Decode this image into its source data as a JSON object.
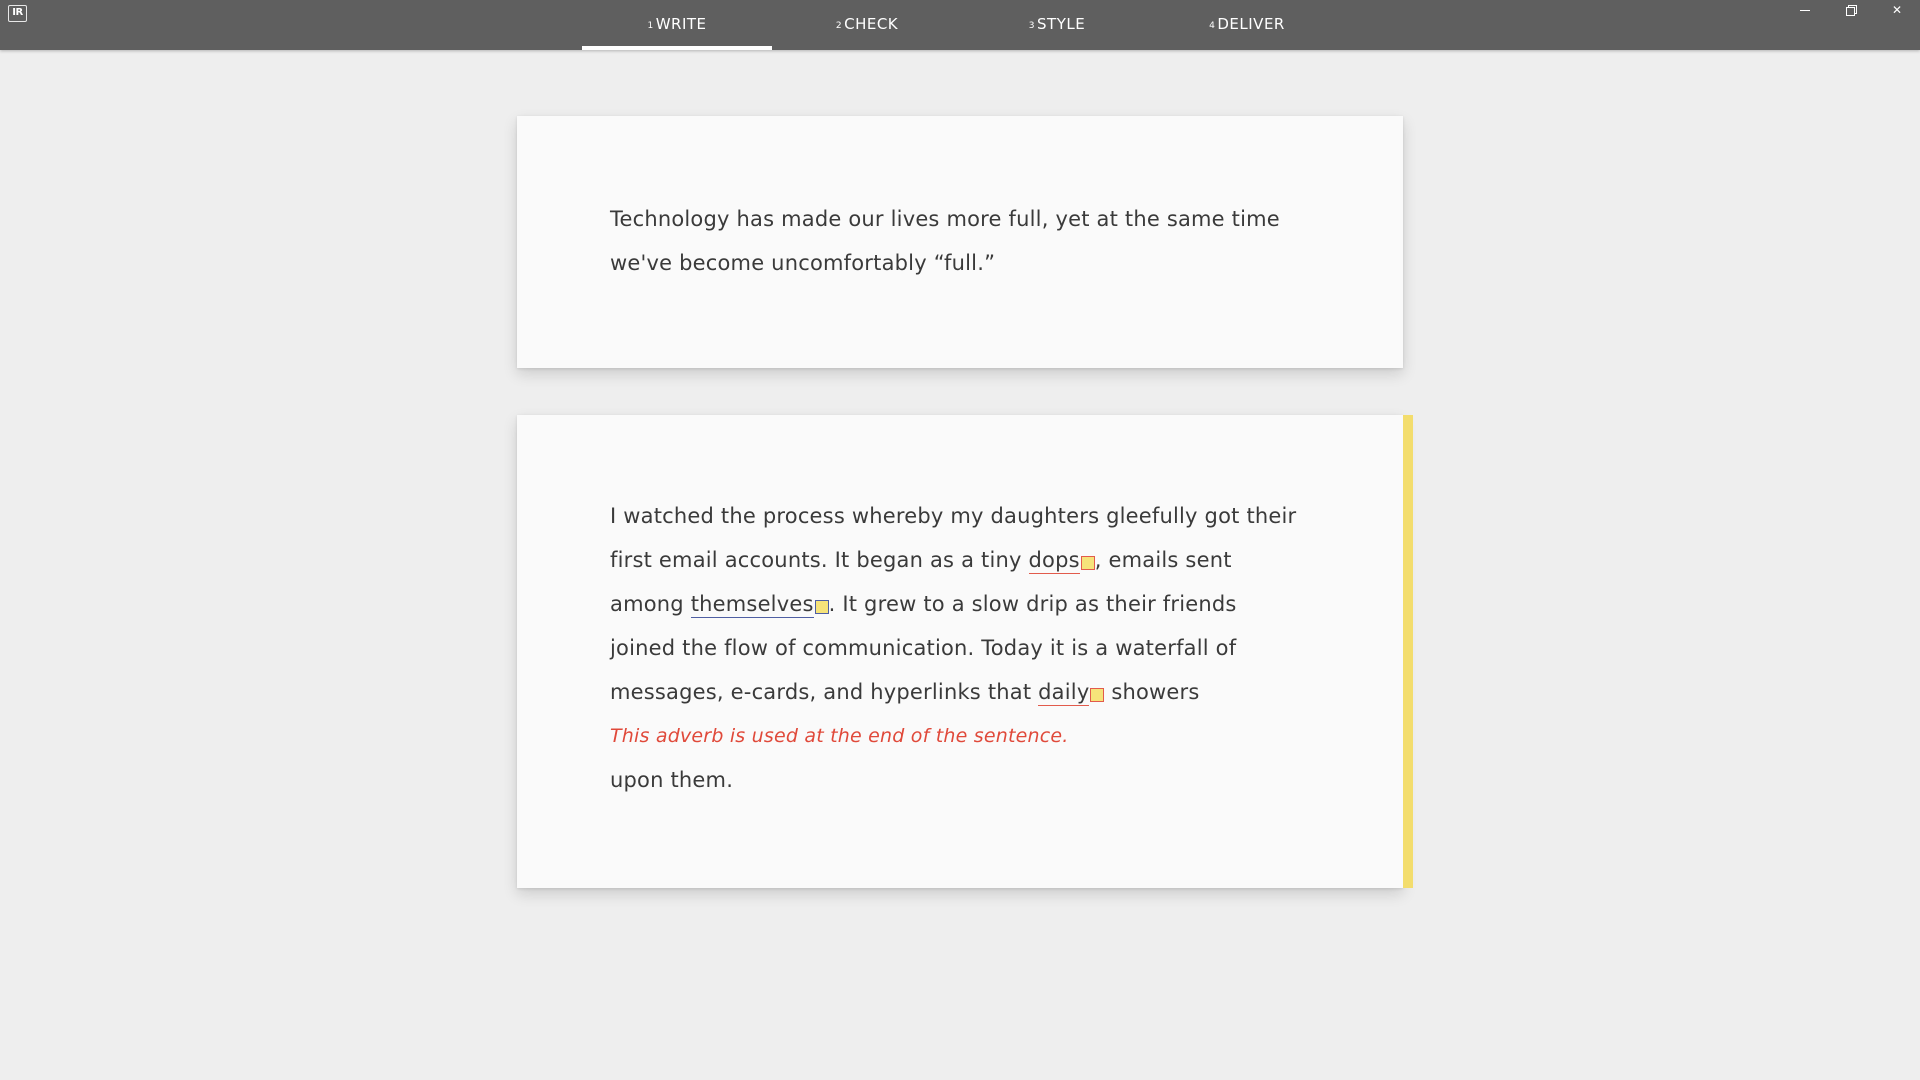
{
  "titlebar": {
    "logo": "IR",
    "tabs": [
      {
        "num": "1",
        "label": "WRITE",
        "active": true
      },
      {
        "num": "2",
        "label": "CHECK",
        "active": false
      },
      {
        "num": "3",
        "label": "STYLE",
        "active": false
      },
      {
        "num": "4",
        "label": "DELIVER",
        "active": false
      }
    ],
    "window_controls": [
      "minimize-icon",
      "restore-icon",
      "close-icon"
    ],
    "close_glyph": "✕"
  },
  "card1": {
    "lines": [
      "Technology has made our lives more full, yet at the same time",
      "we've become uncomfortably “full.”"
    ]
  },
  "card2": {
    "accent_color": "#f3dd6d",
    "line1": "I watched the process whereby my daughters gleefully got their",
    "line2_a": "first email accounts. It began as a tiny ",
    "line2_flag": "dops",
    "line2_b": ", emails sent",
    "line3_a": "among ",
    "line3_flag": "themselves",
    "line3_b": ". It grew to a slow drip as their friends",
    "line4": "joined the flow of communication. Today it is a waterfall of",
    "line5_a": "messages, e-cards, and hyperlinks that ",
    "line5_flag": "daily",
    "line5_b": " showers",
    "hint": "This adverb is used at the end of the sentence.",
    "line6": "upon them."
  },
  "colors": {
    "titlebar": "#5f5f5f",
    "background": "#eeeeee",
    "card": "#fafafa",
    "error_underline": "#e25b4c",
    "style_underline": "#4f5fa3",
    "marker_fill": "#f6e37a",
    "hint_text": "#e0493a"
  }
}
